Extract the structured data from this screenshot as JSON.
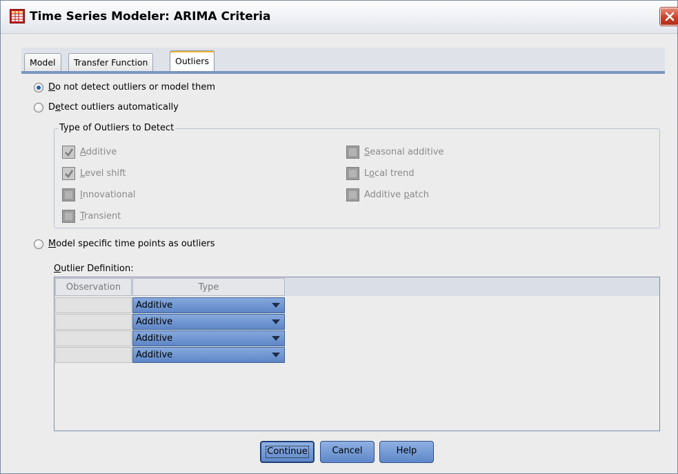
{
  "window": {
    "title": "Time Series Modeler: ARIMA Criteria"
  },
  "tabs": [
    {
      "label": "Model",
      "active": false
    },
    {
      "label": "Transfer Function",
      "active": false
    },
    {
      "label": "Outliers",
      "active": true
    }
  ],
  "options": {
    "no_detect": {
      "underline": "D",
      "rest": "o not detect outliers or model them",
      "selected": true
    },
    "detect_auto": {
      "pre": "D",
      "underline": "e",
      "rest": "tect outliers automatically",
      "selected": false
    },
    "model_specific": {
      "underline": "M",
      "rest": "odel specific time points as outliers",
      "selected": false
    }
  },
  "outlier_types": {
    "legend": "Type of Outliers to Detect",
    "items": [
      {
        "underline": "A",
        "rest": "dditive",
        "checked": true
      },
      {
        "underline": "L",
        "rest": "evel shift",
        "checked": true
      },
      {
        "underline": "I",
        "rest": "nnovational",
        "checked": false
      },
      {
        "underline": "T",
        "rest": "ransient",
        "checked": false
      },
      {
        "underline": "S",
        "rest": "easonal additive",
        "checked": false
      },
      {
        "pre": "L",
        "underline": "o",
        "rest": "cal trend",
        "checked": false
      },
      {
        "pre": "Additive ",
        "underline": "p",
        "rest": "atch",
        "checked": false
      }
    ]
  },
  "outlier_definition": {
    "label_underline": "O",
    "label_rest": "utlier Definition:",
    "columns": [
      "Observation",
      "Type"
    ],
    "rows": [
      {
        "observation": "",
        "type": "Additive"
      },
      {
        "observation": "",
        "type": "Additive"
      },
      {
        "observation": "",
        "type": "Additive"
      },
      {
        "observation": "",
        "type": "Additive"
      }
    ]
  },
  "buttons": {
    "continue": "Continue",
    "cancel": "Cancel",
    "help": "Help"
  },
  "colors": {
    "accent": "#1f5bc4",
    "tab_underline": "#7995c2",
    "button": "#6f94d0",
    "close": "#c94128"
  }
}
